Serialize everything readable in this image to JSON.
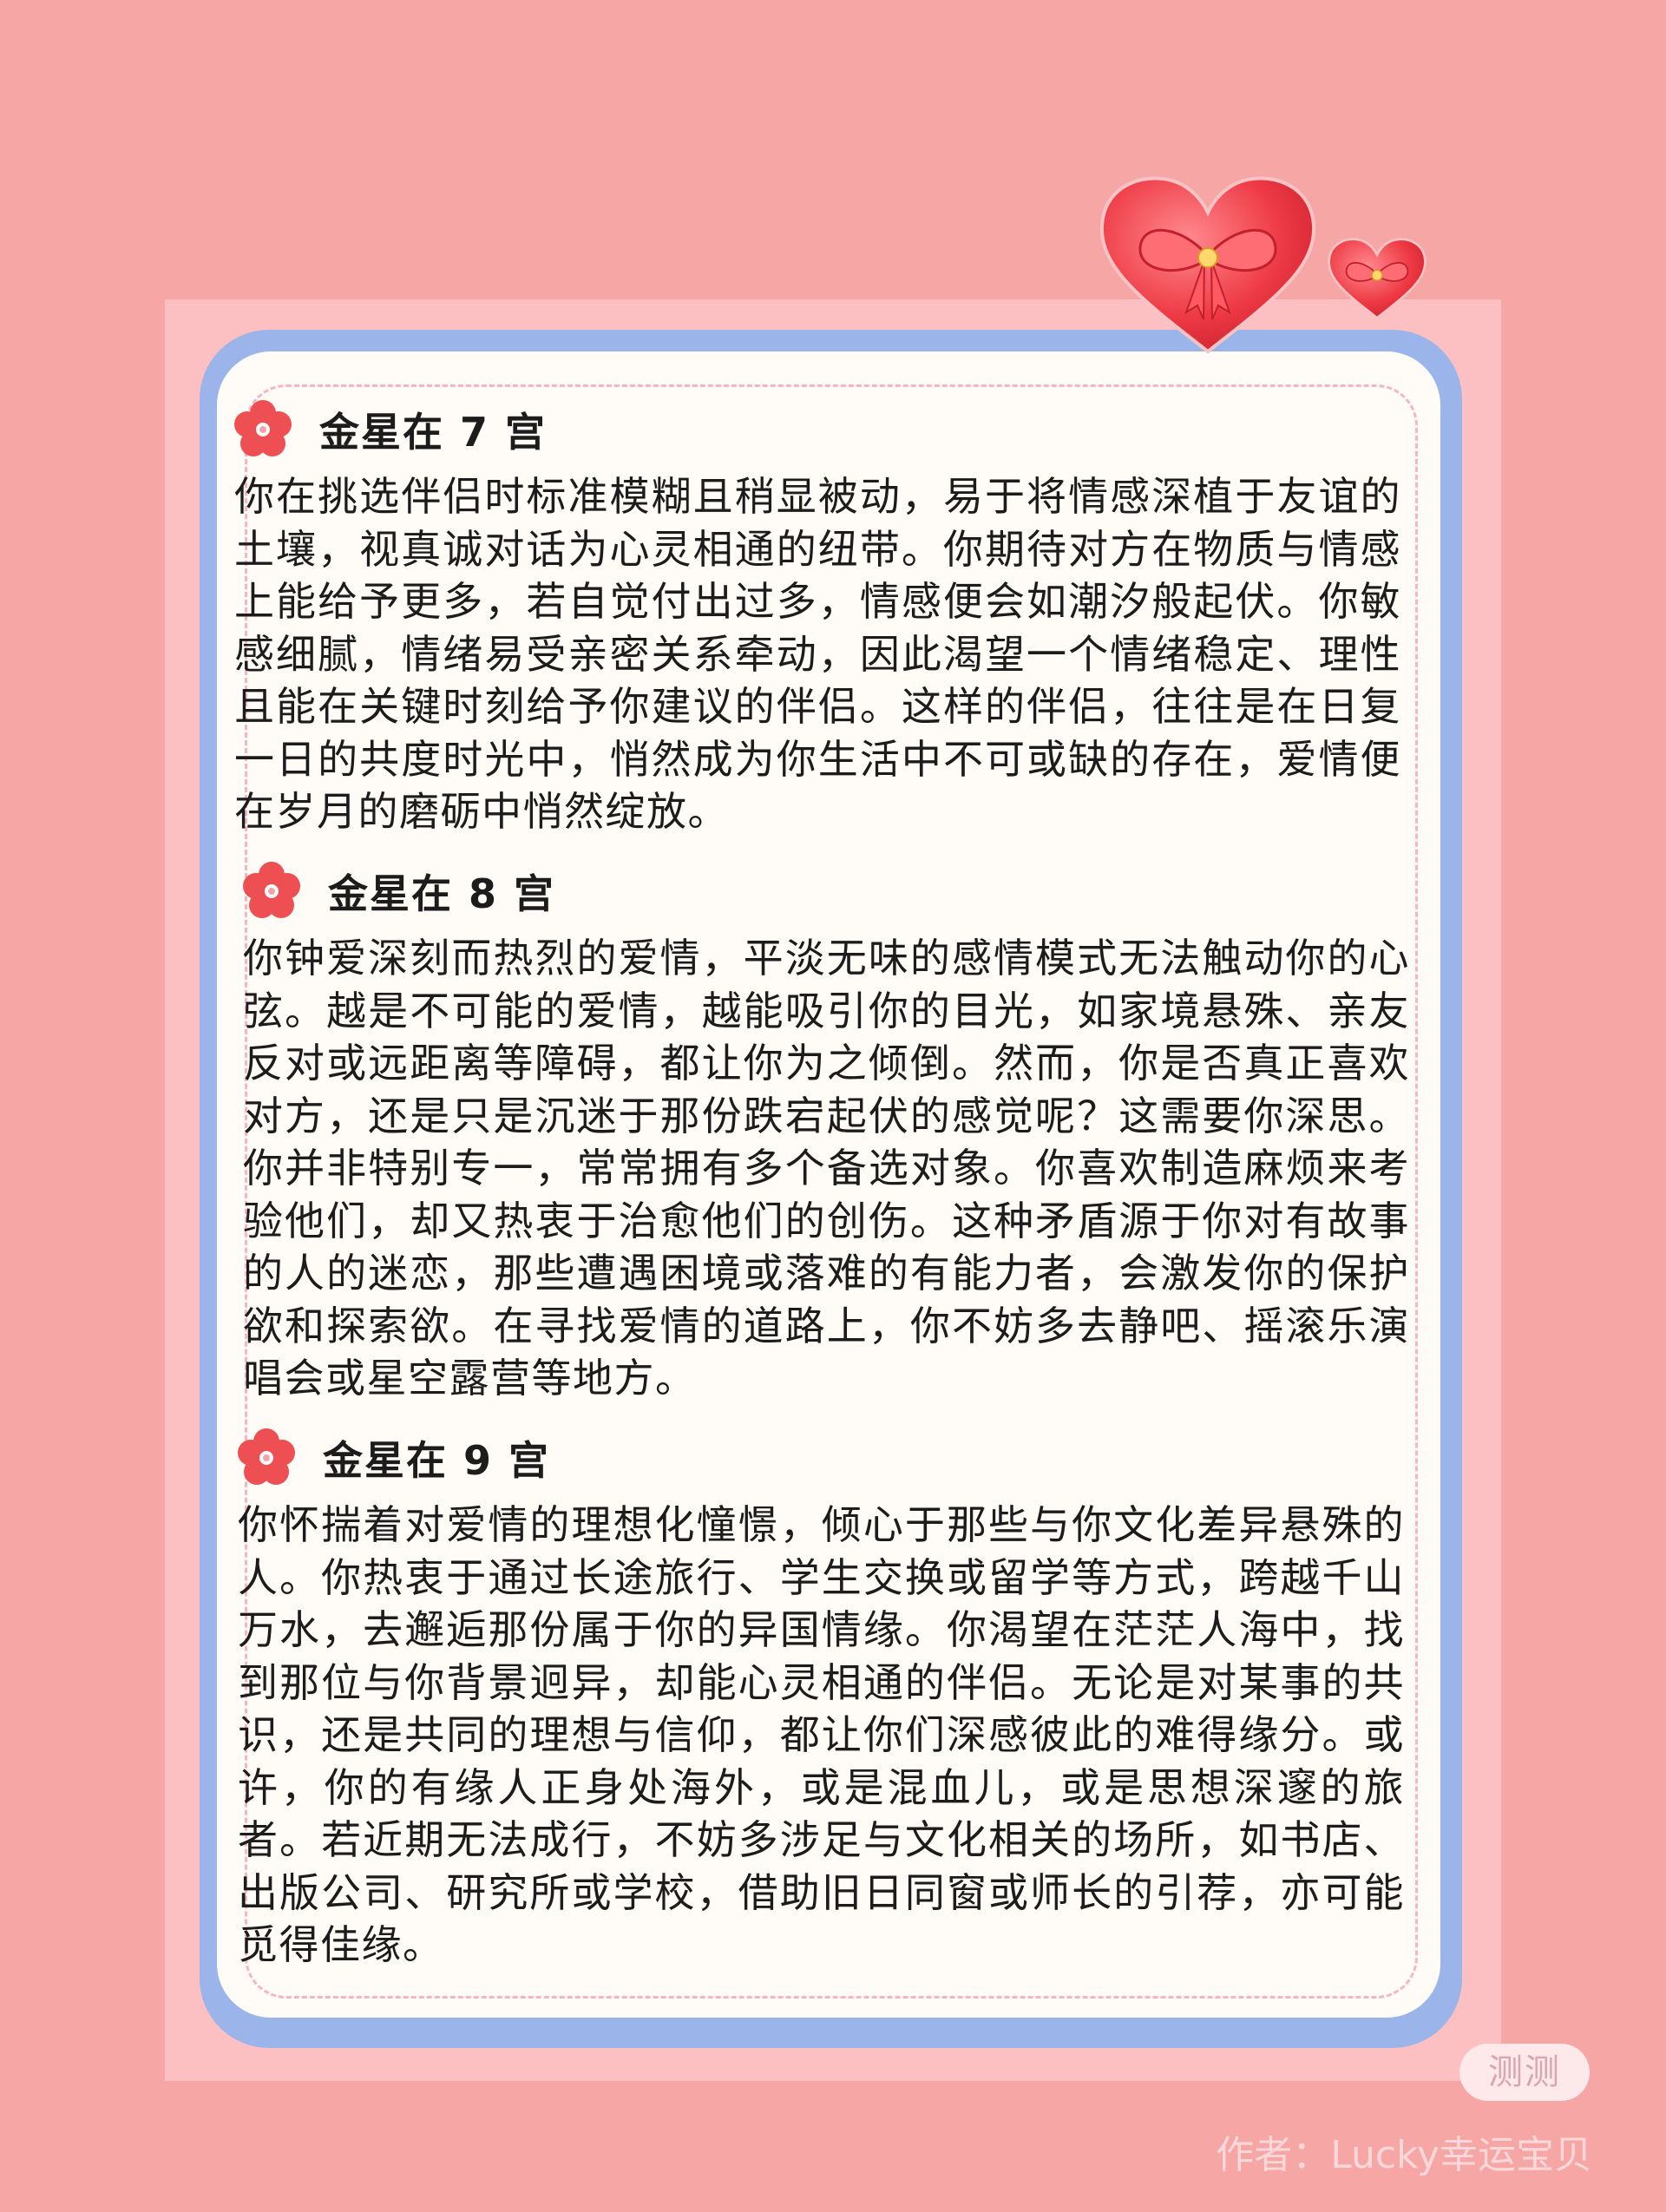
{
  "sections": [
    {
      "title": "金星在 7 宫",
      "body": "你在挑选伴侣时标准模糊且稍显被动，易于将情感深植于友谊的土壤，视真诚对话为心灵相通的纽带。你期待对方在物质与情感上能给予更多，若自觉付出过多，情感便会如潮汐般起伏。你敏感细腻，情绪易受亲密关系牵动，因此渴望一个情绪稳定、理性且能在关键时刻给予你建议的伴侣。这样的伴侣，往往是在日复一日的共度时光中，悄然成为你生活中不可或缺的存在，爱情便在岁月的磨砺中悄然绽放。"
    },
    {
      "title": "金星在 8 宫",
      "body": "你钟爱深刻而热烈的爱情，平淡无味的感情模式无法触动你的心弦。越是不可能的爱情，越能吸引你的目光，如家境悬殊、亲友反对或远距离等障碍，都让你为之倾倒。然而，你是否真正喜欢对方，还是只是沉迷于那份跌宕起伏的感觉呢？这需要你深思。你并非特别专一，常常拥有多个备选对象。你喜欢制造麻烦来考验他们，却又热衷于治愈他们的创伤。这种矛盾源于你对有故事的人的迷恋，那些遭遇困境或落难的有能力者，会激发你的保护欲和探索欲。在寻找爱情的道路上，你不妨多去静吧、摇滚乐演唱会或星空露营等地方。"
    },
    {
      "title": "金星在 9 宫",
      "body": "你怀揣着对爱情的理想化憧憬，倾心于那些与你文化差异悬殊的人。你热衷于通过长途旅行、学生交换或留学等方式，跨越千山万水，去邂逅那份属于你的异国情缘。你渴望在茫茫人海中，找到那位与你背景迥异，却能心灵相通的伴侣。无论是对某事的共识，还是共同的理想与信仰，都让你们深感彼此的难得缘分。或许，你的有缘人正身处海外，或是混血儿，或是思想深邃的旅者。若近期无法成行，不妨多涉足与文化相关的场所，如书店、出版公司、研究所或学校，借助旧日同窗或师长的引荐，亦可能觅得佳缘。"
    }
  ],
  "watermark": {
    "badge": "测测",
    "author": "作者：Lucky幸运宝贝"
  },
  "colors": {
    "background": "#f7a6a6",
    "sheet": "#fcc0c3",
    "card_border": "#9bb4ea",
    "card": "#fffcf7",
    "flower": "#ee4f52",
    "heart": "#ee3a45"
  },
  "icons": [
    "flower-icon",
    "heart-bow-icon"
  ]
}
